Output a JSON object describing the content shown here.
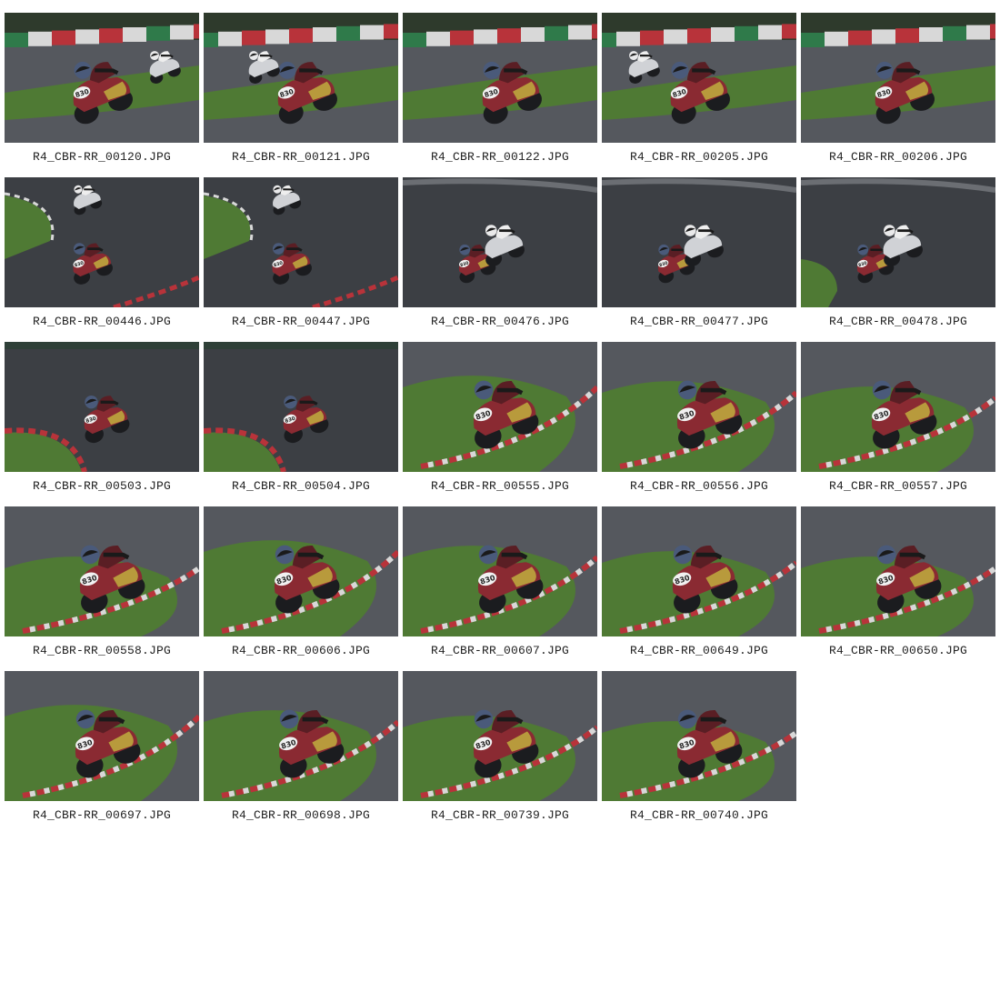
{
  "gallery": {
    "images": [
      {
        "filename": "R4_CBR-RR_00120.JPG",
        "scene": "wide-kerb",
        "riders": 2
      },
      {
        "filename": "R4_CBR-RR_00121.JPG",
        "scene": "wide-kerb",
        "riders": 2
      },
      {
        "filename": "R4_CBR-RR_00122.JPG",
        "scene": "wide-kerb",
        "riders": 1
      },
      {
        "filename": "R4_CBR-RR_00205.JPG",
        "scene": "wide-kerb",
        "riders": 2
      },
      {
        "filename": "R4_CBR-RR_00206.JPG",
        "scene": "wide-kerb",
        "riders": 1
      },
      {
        "filename": "R4_CBR-RR_00446.JPG",
        "scene": "dark-track",
        "riders": 2
      },
      {
        "filename": "R4_CBR-RR_00447.JPG",
        "scene": "dark-track",
        "riders": 2
      },
      {
        "filename": "R4_CBR-RR_00476.JPG",
        "scene": "dark-track",
        "riders": 2
      },
      {
        "filename": "R4_CBR-RR_00477.JPG",
        "scene": "dark-track",
        "riders": 2
      },
      {
        "filename": "R4_CBR-RR_00478.JPG",
        "scene": "dark-track",
        "riders": 2
      },
      {
        "filename": "R4_CBR-RR_00503.JPG",
        "scene": "corner-kerb",
        "riders": 1
      },
      {
        "filename": "R4_CBR-RR_00504.JPG",
        "scene": "corner-kerb",
        "riders": 1
      },
      {
        "filename": "R4_CBR-RR_00555.JPG",
        "scene": "close-grass",
        "riders": 1
      },
      {
        "filename": "R4_CBR-RR_00556.JPG",
        "scene": "close-grass",
        "riders": 1
      },
      {
        "filename": "R4_CBR-RR_00557.JPG",
        "scene": "close-grass",
        "riders": 1
      },
      {
        "filename": "R4_CBR-RR_00558.JPG",
        "scene": "close-grass",
        "riders": 1
      },
      {
        "filename": "R4_CBR-RR_00606.JPG",
        "scene": "close-grass",
        "riders": 1
      },
      {
        "filename": "R4_CBR-RR_00607.JPG",
        "scene": "close-grass",
        "riders": 1
      },
      {
        "filename": "R4_CBR-RR_00649.JPG",
        "scene": "close-grass",
        "riders": 1
      },
      {
        "filename": "R4_CBR-RR_00650.JPG",
        "scene": "close-grass",
        "riders": 1
      },
      {
        "filename": "R4_CBR-RR_00697.JPG",
        "scene": "close-grass",
        "riders": 1
      },
      {
        "filename": "R4_CBR-RR_00698.JPG",
        "scene": "close-grass",
        "riders": 1
      },
      {
        "filename": "R4_CBR-RR_00739.JPG",
        "scene": "close-grass",
        "riders": 1
      },
      {
        "filename": "R4_CBR-RR_00740.JPG",
        "scene": "close-grass",
        "riders": 1
      }
    ],
    "bike_number": "830",
    "colors": {
      "asphalt": "#55585e",
      "asphalt_dark": "#3c3f44",
      "grass": "#4f7a34",
      "kerb_red": "#b8333a",
      "kerb_white": "#d8d8d8",
      "barrier_green": "#2f7a4a",
      "bike_red": "#8a2a32",
      "bike_yellow": "#b89a3c",
      "helmet_blue": "#4a5a7a"
    }
  }
}
